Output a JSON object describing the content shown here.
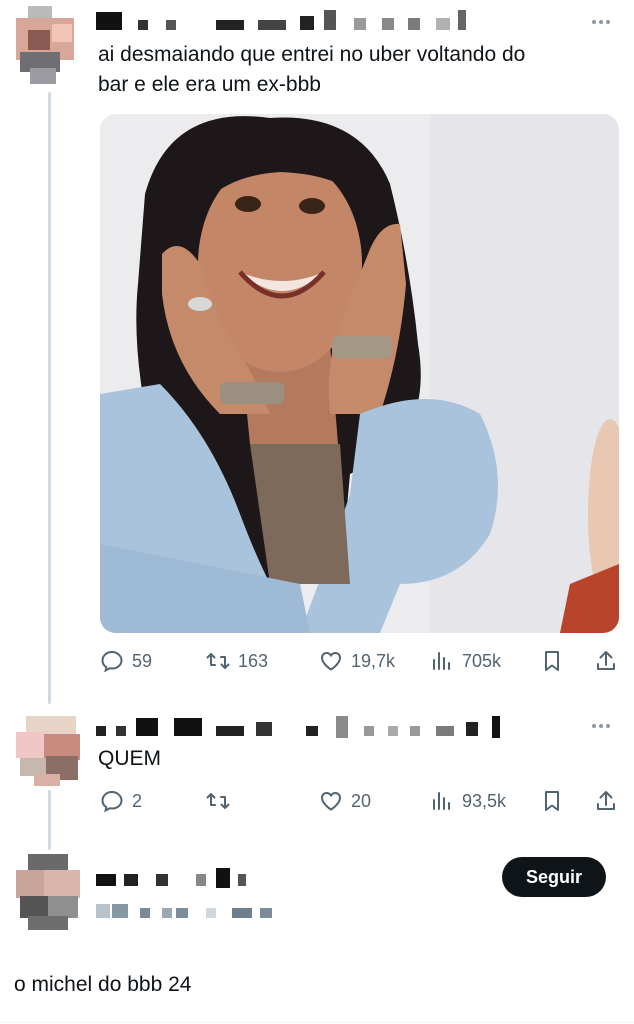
{
  "main_tweet": {
    "text_line1": "ai desmaiando que entrei no uber voltando do",
    "text_line2": "bar e ele era um ex-bbb",
    "actions": {
      "replies": "59",
      "retweets": "163",
      "likes": "19,7k",
      "views": "705k"
    }
  },
  "reply_1": {
    "text": "QUEM",
    "actions": {
      "replies": "2",
      "retweets": "",
      "likes": "20",
      "views": "93,5k"
    }
  },
  "reply_2": {
    "follow_label": "Seguir",
    "text": "o michel do bbb 24"
  },
  "icons": [
    "more-icon",
    "reply-icon",
    "retweet-icon",
    "like-icon",
    "views-icon",
    "bookmark-icon",
    "share-icon"
  ],
  "colors": {
    "text": "#0f1419",
    "muted": "#536471",
    "thread_line": "#cfd9de",
    "follow_button": "#0f1419",
    "photo_shirt": "#a9c3dc"
  }
}
